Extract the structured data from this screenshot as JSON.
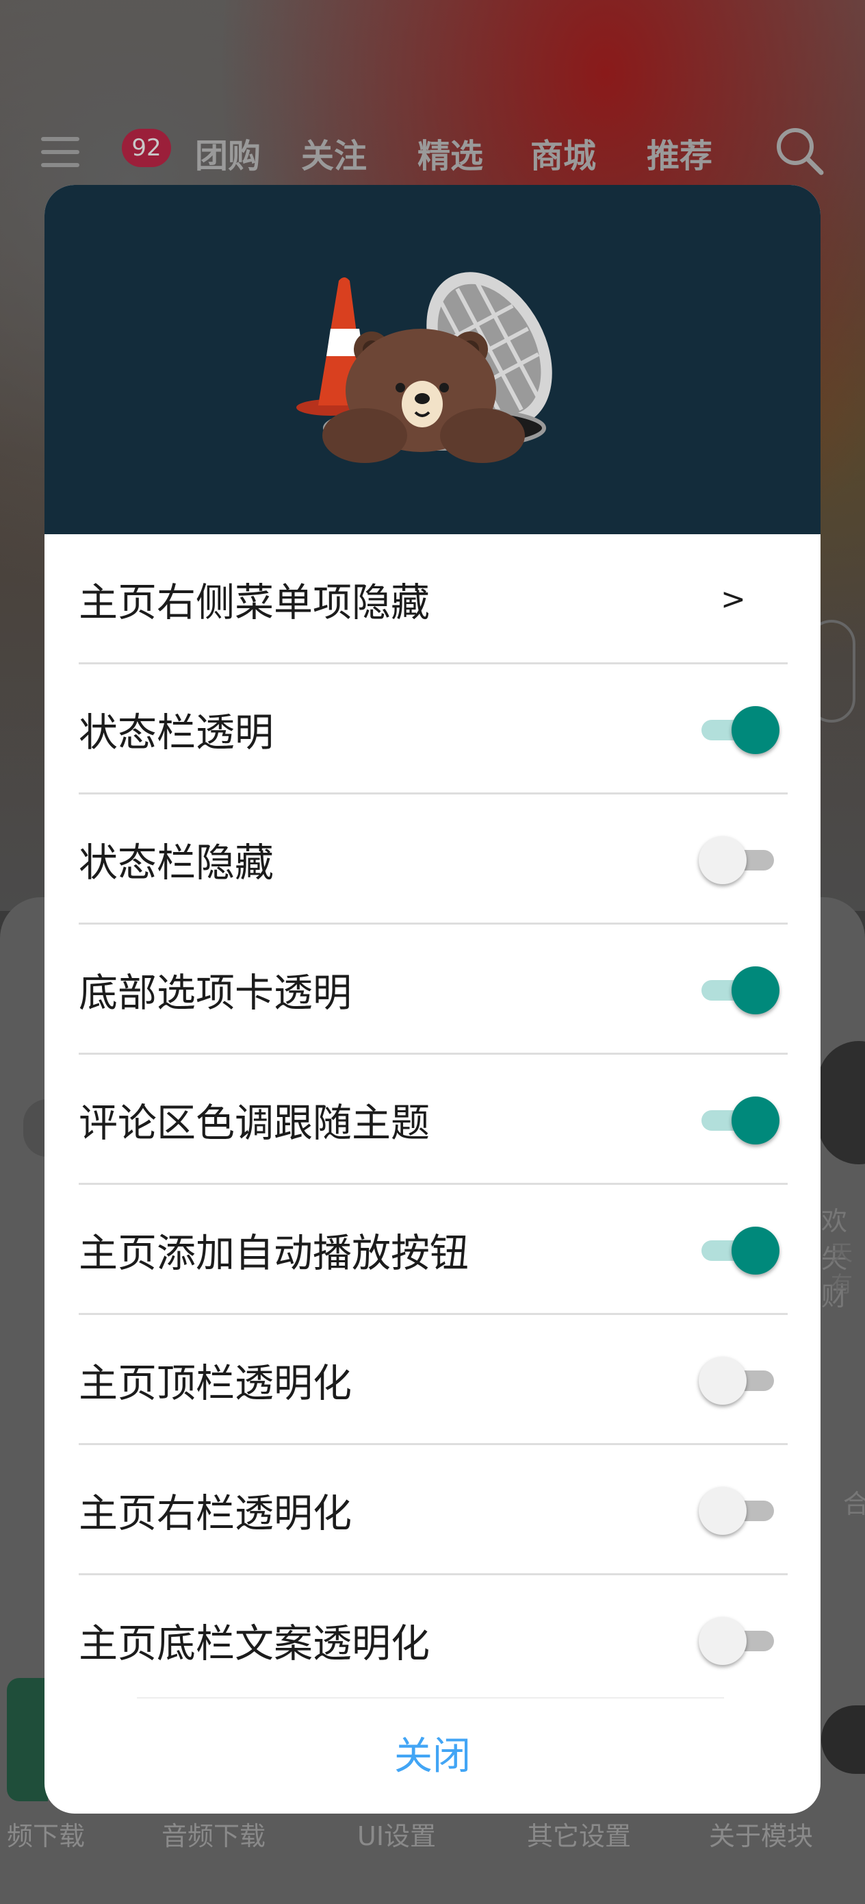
{
  "background_app": {
    "menu_badge": "92",
    "top_tabs": [
      "团购",
      "关注",
      "精选",
      "商城",
      "推荐"
    ],
    "bottom_nav": [
      "频下载",
      "音频下载",
      "UI设置",
      "其它设置",
      "关于模块"
    ],
    "edge_texts": [
      "欢失财",
      "天有",
      "合"
    ]
  },
  "dialog": {
    "items": [
      {
        "label": "主页右侧菜单项隐藏",
        "control": "chevron",
        "chevron": ">"
      },
      {
        "label": "状态栏透明",
        "control": "toggle",
        "on": true
      },
      {
        "label": "状态栏隐藏",
        "control": "toggle",
        "on": false
      },
      {
        "label": "底部选项卡透明",
        "control": "toggle",
        "on": true
      },
      {
        "label": "评论区色调跟随主题",
        "control": "toggle",
        "on": true
      },
      {
        "label": "主页添加自动播放按钮",
        "control": "toggle",
        "on": true
      },
      {
        "label": "主页顶栏透明化",
        "control": "toggle",
        "on": false
      },
      {
        "label": "主页右栏透明化",
        "control": "toggle",
        "on": false
      },
      {
        "label": "主页底栏文案透明化",
        "control": "toggle",
        "on": false
      }
    ],
    "close_label": "关闭"
  },
  "colors": {
    "header_bg": "#132c3b",
    "toggle_on_thumb": "#00897b",
    "toggle_on_track": "#b2dfdb",
    "toggle_off_thumb": "#f1f1f1",
    "toggle_off_track": "#bdbdbd",
    "close_text": "#42a5f5"
  },
  "icons": {
    "header_illustration": "bear-in-manhole-illustration",
    "search": "search-icon",
    "menu": "menu-icon"
  }
}
